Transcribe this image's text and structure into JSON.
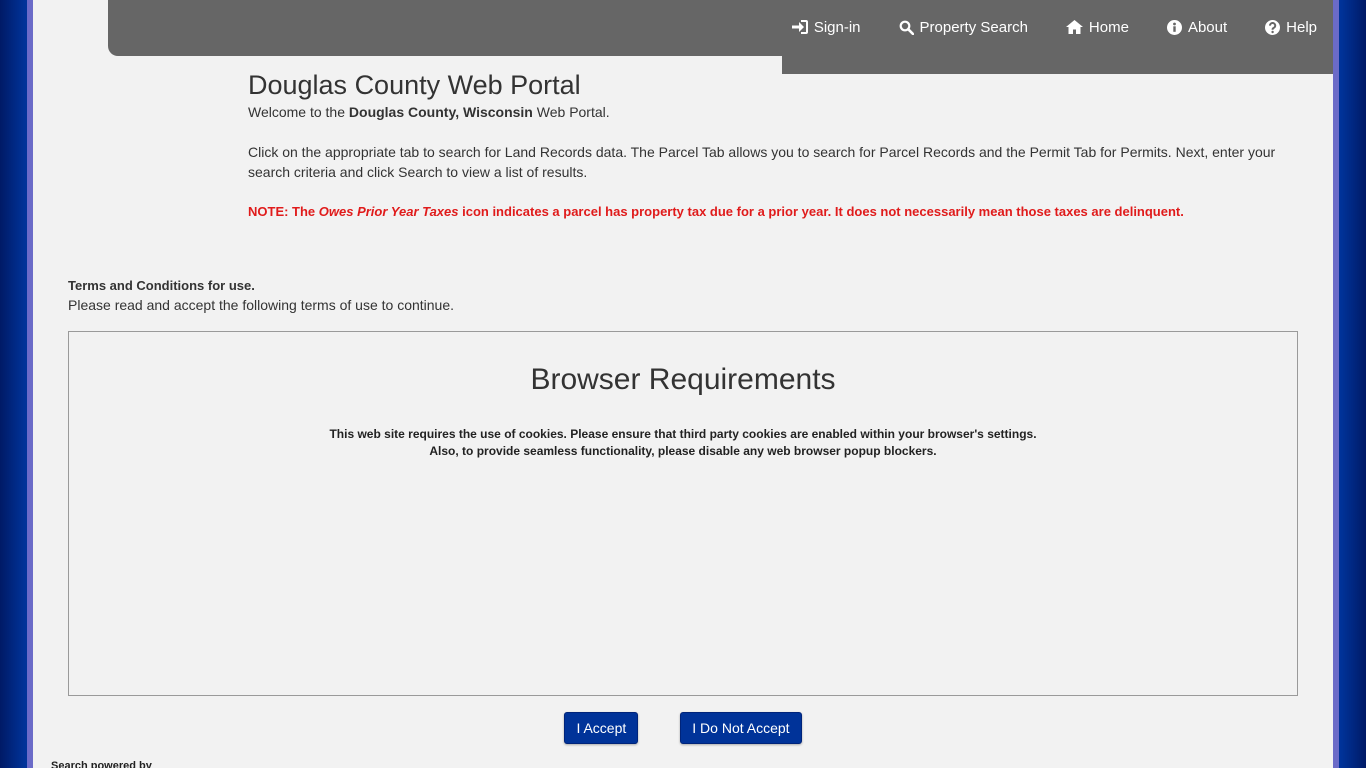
{
  "nav": {
    "items": [
      {
        "label": "Sign-in",
        "icon": "sign-in-icon"
      },
      {
        "label": "Property Search",
        "icon": "search-icon"
      },
      {
        "label": "Home",
        "icon": "home-icon"
      },
      {
        "label": "About",
        "icon": "info-icon"
      },
      {
        "label": "Help",
        "icon": "help-icon"
      }
    ]
  },
  "intro": {
    "title": "Douglas County Web Portal",
    "welcome_prefix": "Welcome to the ",
    "welcome_bold": "Douglas County, Wisconsin",
    "welcome_suffix": " Web Portal.",
    "instructions": "Click on the appropriate tab to search for Land Records data. The Parcel Tab allows you to search for Parcel Records and the Permit Tab for Permits. Next, enter your search criteria and click Search to view a list of results.",
    "note_prefix": "NOTE: The ",
    "note_italic": "Owes Prior Year Taxes",
    "note_suffix": " icon indicates a parcel has property tax due for a prior year. It does not necessarily mean those taxes are delinquent."
  },
  "terms": {
    "heading": "Terms and Conditions for use.",
    "subheading": "Please read and accept the following terms of use to continue.",
    "box_title": "Browser Requirements",
    "box_line1": "This web site requires the use of cookies. Please ensure that third party cookies are enabled within your browser's settings.",
    "box_line2": "Also, to provide seamless functionality, please disable any web browser popup blockers."
  },
  "actions": {
    "accept_label": "I Accept",
    "decline_label": "I Do Not Accept"
  },
  "footer": {
    "text": "Search powered by"
  },
  "colors": {
    "nav_bg": "#666666",
    "note_red": "#e01b1b",
    "button_blue": "#003399",
    "outer_blue": "#003399",
    "frame_purple": "#6b6bc8"
  }
}
